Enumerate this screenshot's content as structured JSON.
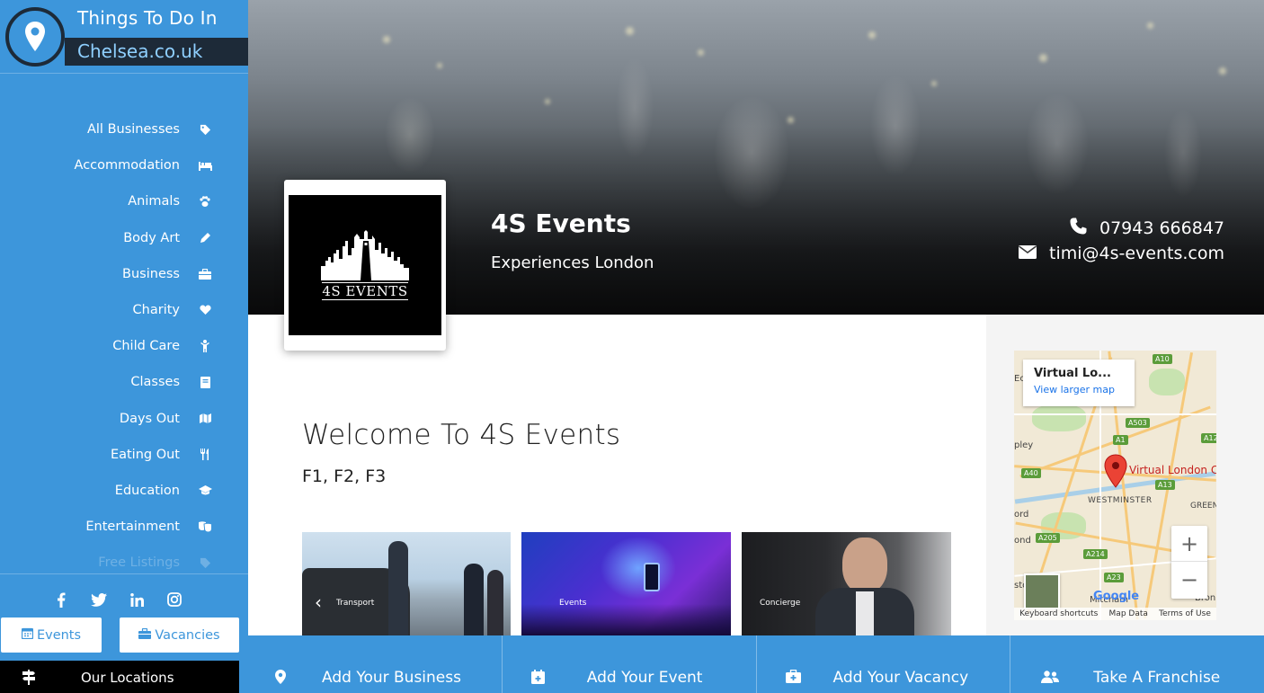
{
  "logo": {
    "line1": "Things To Do In",
    "line2": "Chelsea.co.uk"
  },
  "sidebar": {
    "items": [
      {
        "label": "All Businesses",
        "icon": "tag-icon"
      },
      {
        "label": "Accommodation",
        "icon": "bed-icon"
      },
      {
        "label": "Animals",
        "icon": "paw-icon"
      },
      {
        "label": "Body Art",
        "icon": "pencil-icon"
      },
      {
        "label": "Business",
        "icon": "briefcase-icon"
      },
      {
        "label": "Charity",
        "icon": "heart-icon"
      },
      {
        "label": "Child Care",
        "icon": "child-icon"
      },
      {
        "label": "Classes",
        "icon": "book-icon"
      },
      {
        "label": "Days Out",
        "icon": "map-icon"
      },
      {
        "label": "Eating Out",
        "icon": "cutlery-icon"
      },
      {
        "label": "Education",
        "icon": "graduation-cap-icon"
      },
      {
        "label": "Entertainment",
        "icon": "theater-masks-icon"
      },
      {
        "label": "Free Listings",
        "icon": "tag-icon"
      }
    ],
    "social": [
      "facebook-icon",
      "twitter-icon",
      "linkedin-icon",
      "instagram-icon"
    ],
    "events_label": "Events",
    "vacancies_label": "Vacancies",
    "locations_label": "Our Locations"
  },
  "business": {
    "name": "4S Events",
    "tagline": "Experiences London",
    "phone": "07943 666847",
    "email": "timi@4s-events.com",
    "logo_text": "4S EVENTS"
  },
  "main": {
    "welcome_title": "Welcome To 4S Events",
    "postcodes": "F1, F2, F3",
    "gallery": [
      {
        "caption": "Transport"
      },
      {
        "caption": "Events"
      },
      {
        "caption": "Concierge"
      }
    ]
  },
  "map": {
    "place_title": "Virtual Lo...",
    "larger_map_link": "View larger map",
    "pin_label": "Virtual London C",
    "area_label": "WESTMINSTER",
    "area_label2": "GREEN",
    "area_label3": "Mitcham",
    "left_labels": [
      "Ec",
      "pley",
      "ord",
      "ond",
      "sto",
      "Bron"
    ],
    "roads": [
      "A10",
      "A503",
      "A1",
      "A12",
      "A40",
      "A13",
      "A205",
      "A214",
      "A23"
    ],
    "google_text": "Google",
    "footer": [
      "Keyboard shortcuts",
      "Map Data",
      "Terms of Use"
    ],
    "zoom_in": "+",
    "zoom_out": "−"
  },
  "actions": [
    {
      "label": "Add Your Business",
      "icon": "map-marker-icon"
    },
    {
      "label": "Add Your Event",
      "icon": "calendar-plus-icon"
    },
    {
      "label": "Add Your Vacancy",
      "icon": "briefcase-plus-icon"
    },
    {
      "label": "Take A Franchise",
      "icon": "users-icon"
    }
  ]
}
